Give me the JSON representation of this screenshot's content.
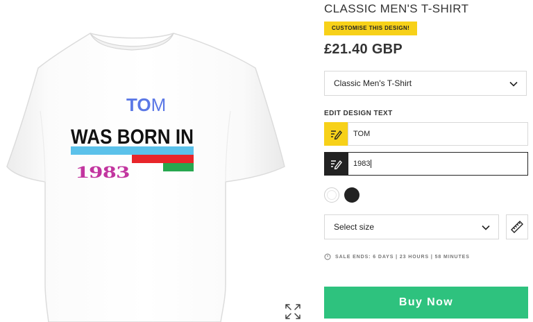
{
  "product": {
    "title": "CLASSIC MEN'S T-SHIRT",
    "customise_label": "CUSTOMISE THIS DESIGN!",
    "price": "£21.40 GBP",
    "style_select": {
      "value": "Classic Men's T-Shirt"
    },
    "edit_heading": "EDIT DESIGN TEXT",
    "text_fields": [
      {
        "value": "TOM",
        "icon": "edit-text-icon"
      },
      {
        "value": "1983",
        "icon": "edit-text-icon"
      }
    ],
    "colors": [
      {
        "name": "white",
        "hex": "#ffffff"
      },
      {
        "name": "black",
        "hex": "#222222"
      }
    ],
    "size_select": {
      "value": "Select size"
    },
    "sale_text": "SALE ENDS: 6 DAYS | 23 HOURS | 58 MINUTES",
    "buy_label": "Buy Now"
  },
  "design": {
    "name_first": "TO",
    "name_last": "M",
    "line2": "WAS BORN IN",
    "year": "1983"
  },
  "colors": {
    "accent_yellow": "#f7d119",
    "buy_green": "#2ec27e",
    "stripe_blue": "#5bc1ea",
    "stripe_red": "#e8252a",
    "stripe_green": "#27a74f",
    "year_magenta": "#c2359f",
    "name_blue": "#5b78e6"
  }
}
